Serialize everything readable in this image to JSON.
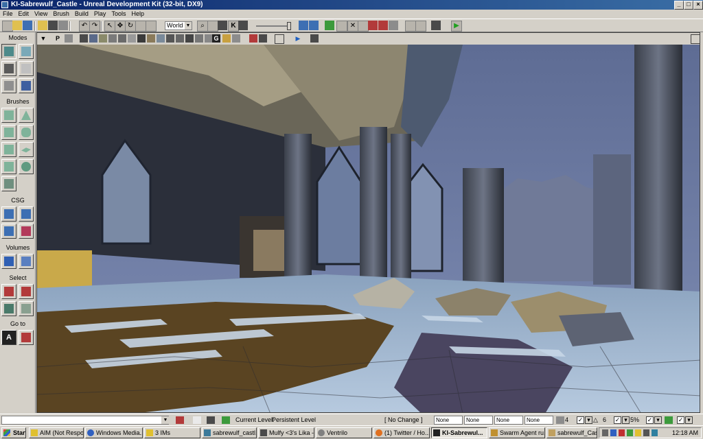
{
  "window": {
    "title": "KI-Sabrewulf_Castle - Unreal Development Kit (32-bit, DX9)",
    "minimize": "_",
    "maximize": "□",
    "close": "×"
  },
  "menu": [
    "File",
    "Edit",
    "View",
    "Brush",
    "Build",
    "Play",
    "Tools",
    "Help"
  ],
  "toolbar": {
    "coordinate_system": "World"
  },
  "modes_panel": {
    "sections": {
      "modes": "Modes",
      "brushes": "Brushes",
      "csg": "CSG",
      "volumes": "Volumes",
      "select": "Select",
      "goto": "Go to"
    },
    "goto_actor": "A"
  },
  "viewport": {
    "perspective_label": "P",
    "g_label": "G",
    "k_label": "K"
  },
  "statusbar": {
    "current_level_label": "Current Level:",
    "current_level_value": "Persistent Level",
    "change_dropdown": "[ No Change ]",
    "fields": [
      "None",
      "None",
      "None",
      "None"
    ],
    "grid_size": "4",
    "rotation_snap": "6",
    "scale_snap": "5%"
  },
  "taskbar": {
    "start": "Start",
    "items": [
      {
        "label": "AIM (Not Respo...",
        "pressed": false
      },
      {
        "label": "Windows Media...",
        "pressed": false
      },
      {
        "label": "3 IMs",
        "pressed": false
      },
      {
        "label": "sabrewulf_castl...",
        "pressed": false
      },
      {
        "label": "Mulfy <3's Lika -...",
        "pressed": false
      },
      {
        "label": "Ventrilo",
        "pressed": false
      },
      {
        "label": "(1) Twitter / Ho...",
        "pressed": false
      },
      {
        "label": "KI-Sabrewul...",
        "pressed": true
      },
      {
        "label": "Swarm Agent ru...",
        "pressed": false
      },
      {
        "label": "sabrewulf_Castl...",
        "pressed": false
      }
    ],
    "clock": "12:18 AM"
  },
  "colors": {
    "title_bar": "#0a246a",
    "chrome": "#d4d0c8",
    "sky": "#6b7ba3",
    "floor_lit": "#a9c0d8",
    "floor_shadow": "#5a4422",
    "play_green": "#3c9a3c"
  }
}
